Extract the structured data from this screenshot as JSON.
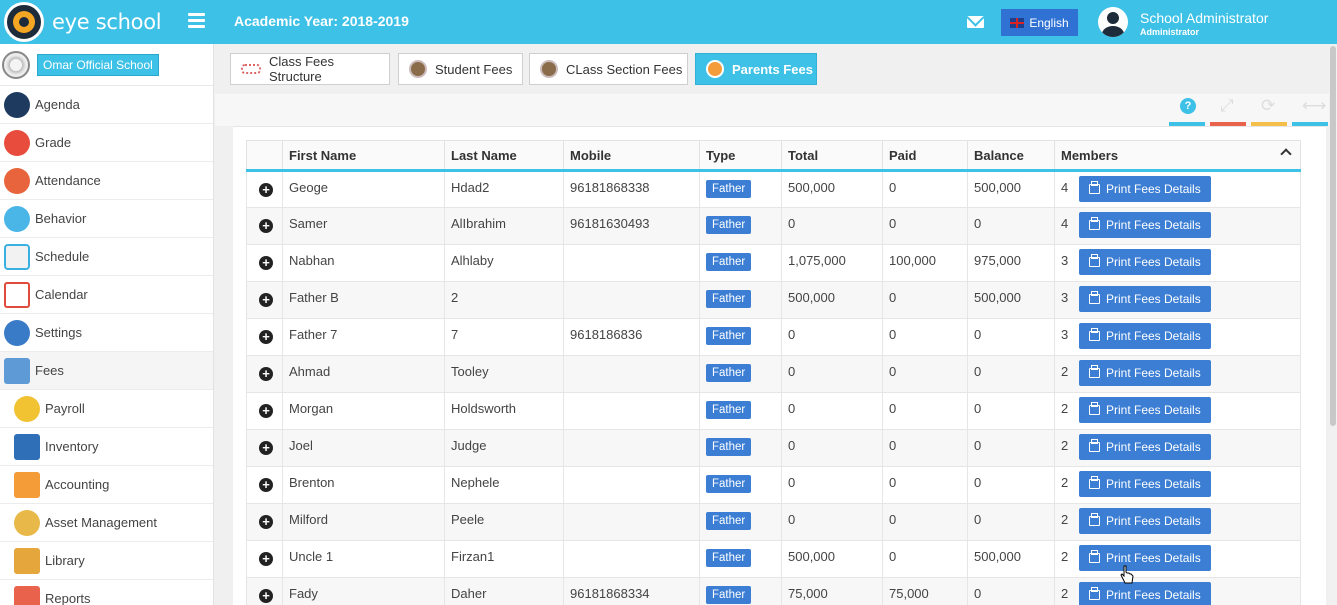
{
  "app": {
    "name": "eye school",
    "academic_year": "Academic Year: 2018-2019"
  },
  "header": {
    "language": "English",
    "user_name": "School Administrator",
    "user_role": "Administrator"
  },
  "school": {
    "name": "Omar Official School"
  },
  "sidebar": {
    "items": [
      {
        "label": "Agenda",
        "icon": "agenda-icon"
      },
      {
        "label": "Grade",
        "icon": "grade-icon"
      },
      {
        "label": "Attendance",
        "icon": "attendance-icon"
      },
      {
        "label": "Behavior",
        "icon": "behavior-icon"
      },
      {
        "label": "Schedule",
        "icon": "schedule-icon"
      },
      {
        "label": "Calendar",
        "icon": "calendar-icon"
      },
      {
        "label": "Settings",
        "icon": "settings-icon"
      },
      {
        "label": "Fees",
        "icon": "fees-icon"
      },
      {
        "label": "Payroll",
        "icon": "payroll-icon"
      },
      {
        "label": "Inventory",
        "icon": "inventory-icon"
      },
      {
        "label": "Accounting",
        "icon": "accounting-icon"
      },
      {
        "label": "Asset Management",
        "icon": "asset-management-icon"
      },
      {
        "label": "Library",
        "icon": "library-icon"
      },
      {
        "label": "Reports",
        "icon": "reports-icon"
      }
    ],
    "active": "Fees"
  },
  "tabs": [
    {
      "label": "Class Fees Structure"
    },
    {
      "label": "Student Fees"
    },
    {
      "label": "CLass Section Fees"
    },
    {
      "label": "Parents Fees"
    }
  ],
  "active_tab": "Parents Fees",
  "toolbar_colors": [
    "#3ec1e6",
    "#e8624c",
    "#f5c04a",
    "#3ec1e6"
  ],
  "table": {
    "columns": [
      "First Name",
      "Last Name",
      "Mobile",
      "Type",
      "Total",
      "Paid",
      "Balance",
      "Members"
    ],
    "print_label": "Print Fees Details",
    "rows": [
      {
        "first": "Geoge",
        "last": "Hdad2",
        "mobile": "96181868338",
        "type": "Father",
        "total": "500,000",
        "paid": "0",
        "balance": "500,000",
        "members": "4"
      },
      {
        "first": "Samer",
        "last": "AlIbrahim",
        "mobile": "96181630493",
        "type": "Father",
        "total": "0",
        "paid": "0",
        "balance": "0",
        "members": "4"
      },
      {
        "first": "Nabhan",
        "last": "Alhlaby",
        "mobile": "",
        "type": "Father",
        "total": "1,075,000",
        "paid": "100,000",
        "balance": "975,000",
        "members": "3"
      },
      {
        "first": "Father B",
        "last": "2",
        "mobile": "",
        "type": "Father",
        "total": "500,000",
        "paid": "0",
        "balance": "500,000",
        "members": "3"
      },
      {
        "first": "Father 7",
        "last": "7",
        "mobile": "9618186836",
        "type": "Father",
        "total": "0",
        "paid": "0",
        "balance": "0",
        "members": "3"
      },
      {
        "first": "Ahmad",
        "last": "Tooley",
        "mobile": "",
        "type": "Father",
        "total": "0",
        "paid": "0",
        "balance": "0",
        "members": "2"
      },
      {
        "first": "Morgan",
        "last": "Holdsworth",
        "mobile": "",
        "type": "Father",
        "total": "0",
        "paid": "0",
        "balance": "0",
        "members": "2"
      },
      {
        "first": "Joel",
        "last": "Judge",
        "mobile": "",
        "type": "Father",
        "total": "0",
        "paid": "0",
        "balance": "0",
        "members": "2"
      },
      {
        "first": "Brenton",
        "last": "Nephele",
        "mobile": "",
        "type": "Father",
        "total": "0",
        "paid": "0",
        "balance": "0",
        "members": "2"
      },
      {
        "first": "Milford",
        "last": "Peele",
        "mobile": "",
        "type": "Father",
        "total": "0",
        "paid": "0",
        "balance": "0",
        "members": "2"
      },
      {
        "first": "Uncle 1",
        "last": "Firzan1",
        "mobile": "",
        "type": "Father",
        "total": "500,000",
        "paid": "0",
        "balance": "500,000",
        "members": "2"
      },
      {
        "first": "Fady",
        "last": "Daher",
        "mobile": "96181868334",
        "type": "Father",
        "total": "75,000",
        "paid": "75,000",
        "balance": "0",
        "members": "2"
      }
    ]
  }
}
